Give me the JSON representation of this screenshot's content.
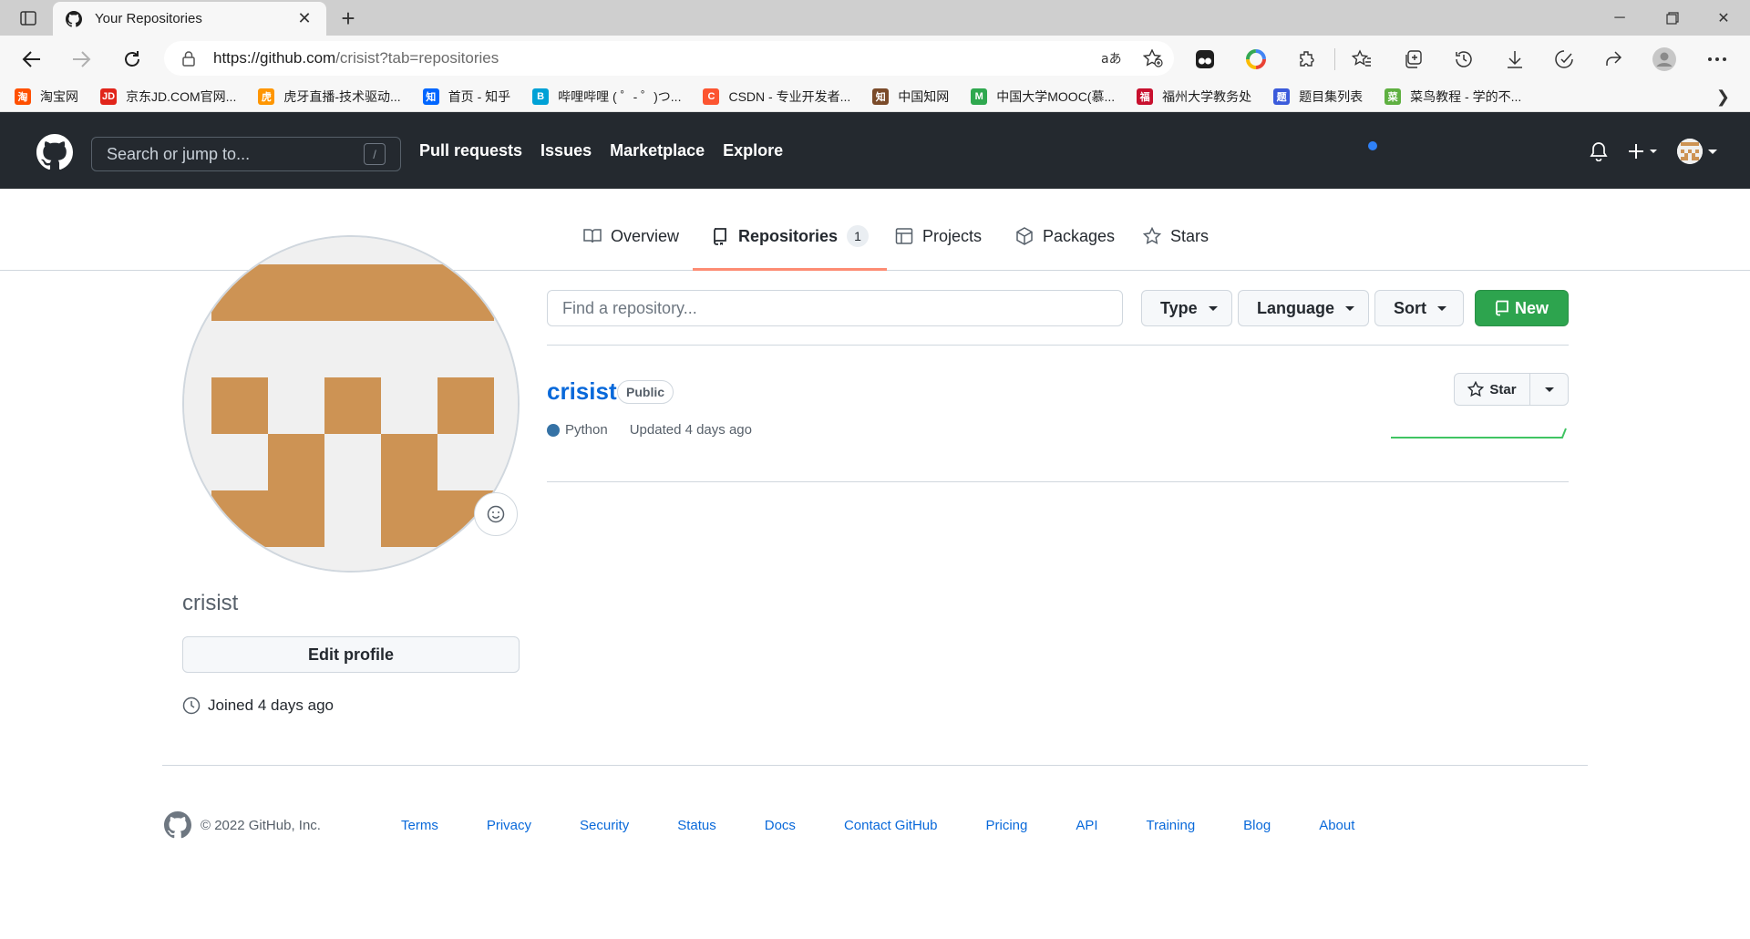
{
  "browser": {
    "tab_title": "Your Repositories",
    "url_host": "https://github.com",
    "url_path": "/crisist?tab=repositories",
    "bookmarks": [
      {
        "label": "淘宝网",
        "color": "#ff5000",
        "glyph": "淘"
      },
      {
        "label": "京东JD.COM官网...",
        "color": "#e1251b",
        "glyph": "JD"
      },
      {
        "label": "虎牙直播-技术驱动...",
        "color": "#ff9600",
        "glyph": "虎"
      },
      {
        "label": "首页 - 知乎",
        "color": "#0066ff",
        "glyph": "知"
      },
      {
        "label": "哔哩哔哩 ( ゜- ゜)つ...",
        "color": "#00a1d6",
        "glyph": "B"
      },
      {
        "label": "CSDN - 专业开发者...",
        "color": "#fc5531",
        "glyph": "C"
      },
      {
        "label": "中国知网",
        "color": "#7b4b2a",
        "glyph": "知"
      },
      {
        "label": "中国大学MOOC(慕...",
        "color": "#2fa84f",
        "glyph": "M"
      },
      {
        "label": "福州大学教务处",
        "color": "#c8102e",
        "glyph": "福"
      },
      {
        "label": "题目集列表",
        "color": "#3b5bdb",
        "glyph": "题"
      },
      {
        "label": "菜鸟教程 - 学的不...",
        "color": "#5fb041",
        "glyph": "菜"
      }
    ]
  },
  "gh_header": {
    "search_placeholder": "Search or jump to...",
    "search_key": "/",
    "nav": [
      "Pull requests",
      "Issues",
      "Marketplace",
      "Explore"
    ]
  },
  "profile_tabs": {
    "overview": "Overview",
    "repositories": "Repositories",
    "repositories_count": "1",
    "projects": "Projects",
    "packages": "Packages",
    "stars": "Stars"
  },
  "profile": {
    "username": "crisist",
    "edit_label": "Edit profile",
    "joined": "Joined 4 days ago"
  },
  "repo_filters": {
    "search_placeholder": "Find a repository...",
    "type_label": "Type",
    "language_label": "Language",
    "sort_label": "Sort",
    "new_label": "New"
  },
  "repos": [
    {
      "name": "crisist",
      "visibility": "Public",
      "language": "Python",
      "language_color": "#3572A5",
      "updated": "Updated 4 days ago",
      "star_label": "Star"
    }
  ],
  "footer": {
    "copyright": "© 2022 GitHub, Inc.",
    "links": [
      "Terms",
      "Privacy",
      "Security",
      "Status",
      "Docs",
      "Contact GitHub",
      "Pricing",
      "API",
      "Training",
      "Blog",
      "About"
    ]
  },
  "colors": {
    "header_bg": "#24292f",
    "link": "#0969da",
    "new_button": "#2da44e",
    "tab_underline": "#fd8c73",
    "identicon": "#cd9354"
  }
}
